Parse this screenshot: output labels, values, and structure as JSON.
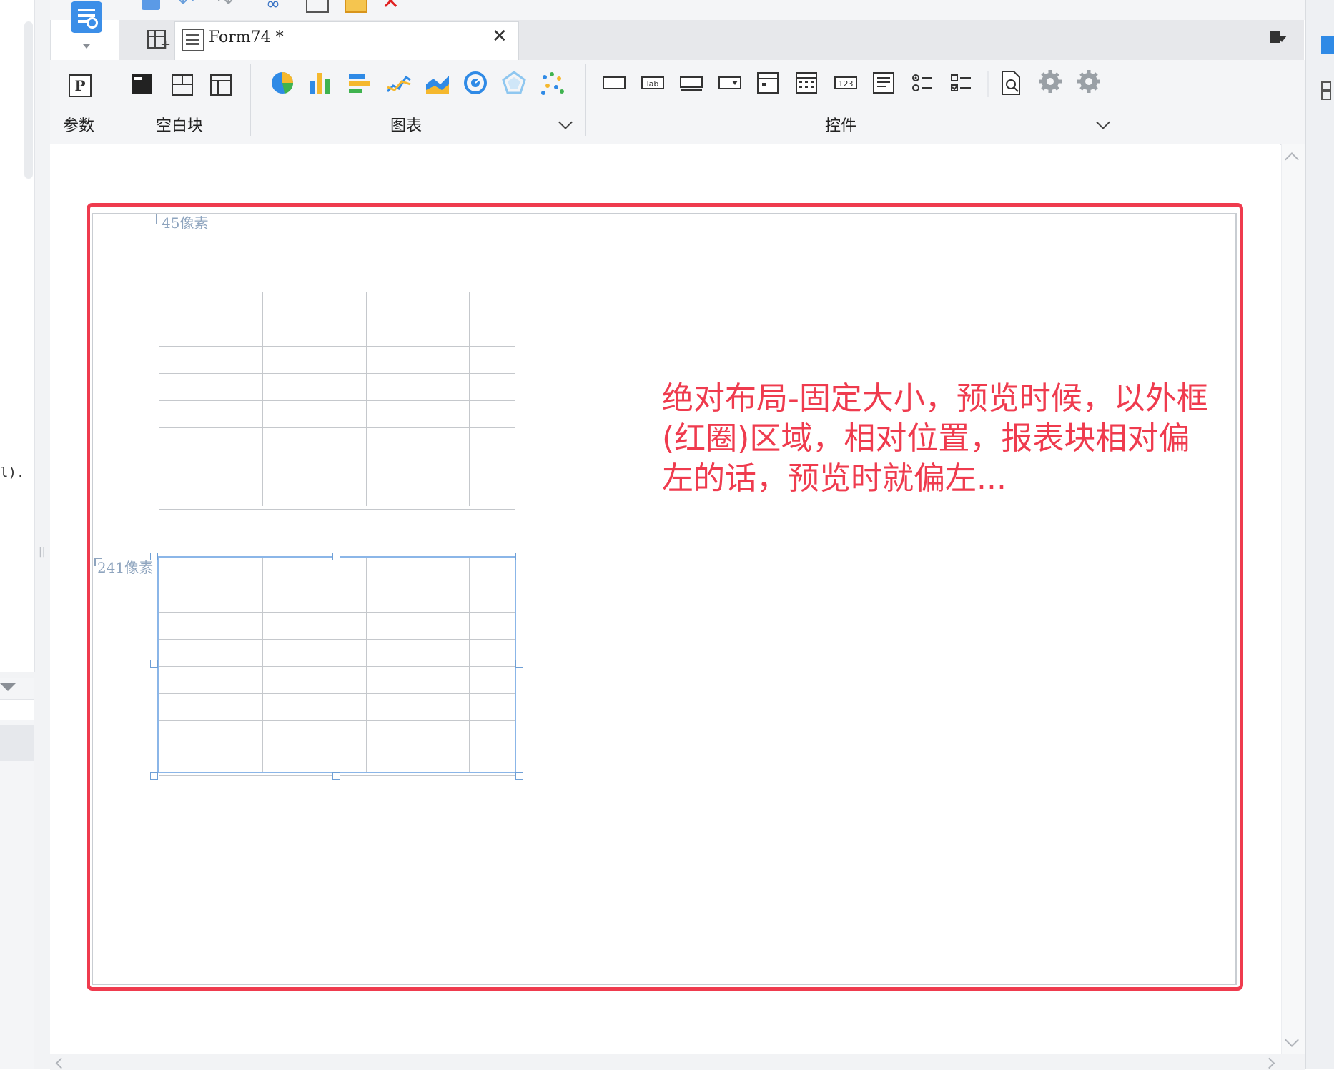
{
  "window": {
    "tab_title": "Form74 *",
    "left_truncated_text": "l)."
  },
  "ribbon": {
    "groups": [
      {
        "label": "参数"
      },
      {
        "label": "空白块"
      },
      {
        "label": "图表"
      },
      {
        "label": "控件"
      }
    ]
  },
  "canvas": {
    "top_offset_label": "45像素",
    "left_offset_label": "241像素",
    "annotation_text": "绝对布局-固定大小，预览时候，以外框(红圈)区域，相对位置，报表块相对偏左的话，预览时就偏左..."
  },
  "colors": {
    "annotation": "#ef3b4e",
    "selection": "#8bb6e8",
    "accent": "#2f8ae6"
  }
}
